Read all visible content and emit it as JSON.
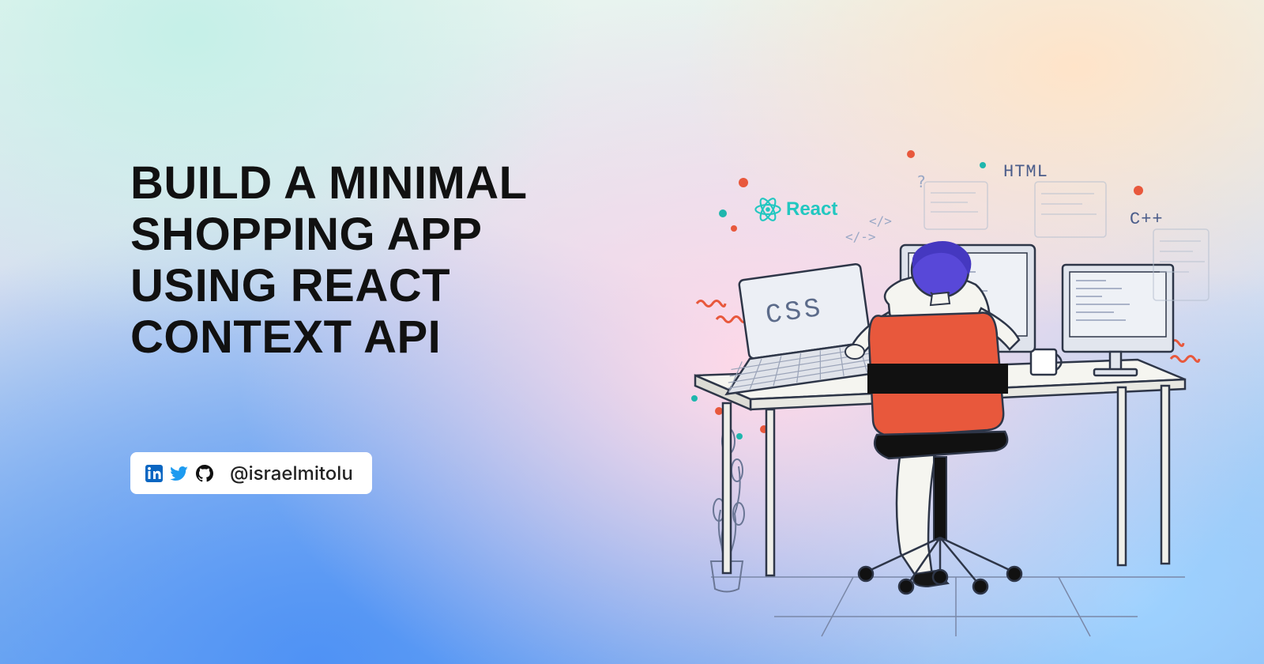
{
  "headline": {
    "line1": "BUILD A MINIMAL",
    "line2": "SHOPPING APP",
    "line3": "USING REACT",
    "line4": "CONTEXT API"
  },
  "social": {
    "handle": "@israelmitolu",
    "icons": [
      "linkedin",
      "twitter",
      "github"
    ]
  },
  "illustration": {
    "labels": {
      "react": "React",
      "html": "HTML",
      "cpp": "C++",
      "css": "CSS"
    },
    "colors": {
      "chair_back": "#e8583c",
      "chair_band": "#111111",
      "hair": "#5848d8",
      "skin": "#f5f5f2",
      "laptop": "#e6e6e6",
      "monitor": "#dce0e8",
      "react_teal": "#22c7c0",
      "accent_orange": "#e8583c",
      "line": "#3a445c"
    }
  }
}
